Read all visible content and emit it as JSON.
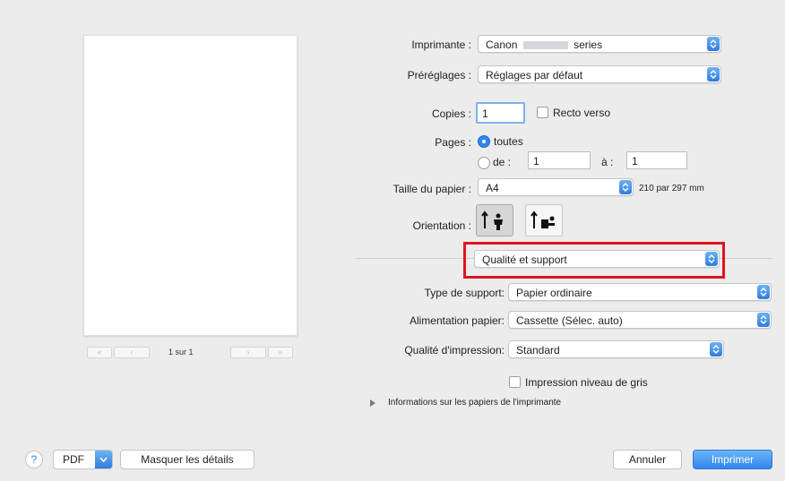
{
  "preview": {
    "page_indicator": "1 sur 1",
    "first_label": "«",
    "prev_label": "‹",
    "next_label": "›",
    "last_label": "»"
  },
  "printer": {
    "label": "Imprimante :",
    "value_prefix": "Canon",
    "value_suffix": "series"
  },
  "presets": {
    "label": "Préréglages :",
    "value": "Réglages par défaut"
  },
  "copies": {
    "label": "Copies :",
    "value": "1",
    "duplex_label": "Recto verso"
  },
  "pages": {
    "label": "Pages :",
    "all_label": "toutes",
    "from_label": "de :",
    "from_value": "1",
    "to_label": "à :",
    "to_value": "1"
  },
  "paper_size": {
    "label": "Taille du papier :",
    "value": "A4",
    "dimensions": "210 par 297 mm"
  },
  "orientation": {
    "label": "Orientation :"
  },
  "section_popup": {
    "value": "Qualité et support"
  },
  "media_type": {
    "label": "Type de support:",
    "value": "Papier ordinaire"
  },
  "paper_source": {
    "label": "Alimentation papier:",
    "value": "Cassette (Sélec. auto)"
  },
  "print_quality": {
    "label": "Qualité d'impression:",
    "value": "Standard"
  },
  "grayscale": {
    "label": "Impression niveau de gris"
  },
  "paper_info": {
    "label": "Informations sur les papiers de l'imprimante"
  },
  "footer": {
    "help_label": "?",
    "pdf_label": "PDF",
    "hide_details_label": "Masquer les détails",
    "cancel_label": "Annuler",
    "print_label": "Imprimer"
  },
  "colors": {
    "accent": "#2f86ef",
    "highlight_border": "#e0141e",
    "background": "#ececec"
  }
}
